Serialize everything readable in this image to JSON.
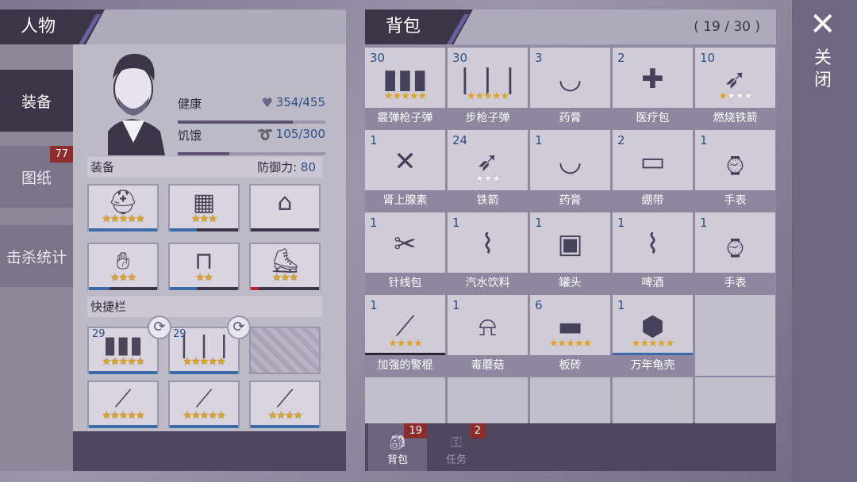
{
  "character": {
    "title": "人物",
    "tabs": [
      {
        "label": "装备"
      },
      {
        "label": "图纸",
        "badge": "77"
      },
      {
        "label": "击杀统计"
      }
    ],
    "stats": {
      "health_label": "健康",
      "health_value": "354/455",
      "health_fraction": 0.78,
      "hunger_label": "饥饿",
      "hunger_value": "105/300",
      "hunger_fraction": 0.35
    },
    "equipment_label": "装备",
    "defense_label": "防御力:",
    "defense_value": "80",
    "equipment": [
      {
        "icon": "helmet-icon",
        "stars": "★★★★★",
        "durability": 1.0
      },
      {
        "icon": "armor-vest-icon",
        "stars": "★★★",
        "durability": 0.4
      },
      {
        "icon": "jacket-icon",
        "stars": "",
        "durability": 0
      },
      {
        "icon": "gloves-icon",
        "stars": "★★★",
        "durability": 0.3
      },
      {
        "icon": "shorts-icon",
        "stars": "★★",
        "durability": 0.4
      },
      {
        "icon": "shoes-icon",
        "stars": "★★★",
        "durability": 0.12
      }
    ],
    "quickbar_label": "快捷栏",
    "quickbar": [
      {
        "icon": "shotgun-shell-icon",
        "count": "29",
        "stars": "★★★★★"
      },
      {
        "icon": "rifle-ammo-icon",
        "count": "29",
        "stars": "★★★★★"
      },
      {
        "icon": "empty-slot-icon",
        "count": "",
        "stars": ""
      },
      {
        "icon": "shotgun-icon",
        "count": "",
        "stars": "★★★★★"
      },
      {
        "icon": "rifle-icon",
        "count": "",
        "stars": "★★★★★"
      },
      {
        "icon": "baton-icon",
        "count": "",
        "stars": "★★★★"
      }
    ]
  },
  "backpack": {
    "title": "背包",
    "count": "( 19 / 30 )",
    "items": [
      {
        "qty": "30",
        "name": "霰弹枪子弹",
        "icon": "shotgun-shell-icon",
        "stars": "★★★★★",
        "grey": ""
      },
      {
        "qty": "30",
        "name": "步枪子弹",
        "icon": "rifle-ammo-icon",
        "stars": "★★★★★",
        "grey": ""
      },
      {
        "qty": "3",
        "name": "药膏",
        "icon": "mortar-icon",
        "stars": "",
        "grey": ""
      },
      {
        "qty": "2",
        "name": "医疗包",
        "icon": "medkit-icon",
        "stars": "",
        "grey": ""
      },
      {
        "qty": "10",
        "name": "燃烧铁箭",
        "icon": "fire-arrow-icon",
        "stars": "★",
        "grey": "★★★"
      },
      {
        "qty": "1",
        "name": "肾上腺素",
        "icon": "syringe-icon",
        "stars": "",
        "grey": ""
      },
      {
        "qty": "24",
        "name": "铁箭",
        "icon": "arrow-icon",
        "stars": "",
        "grey": "★★★"
      },
      {
        "qty": "1",
        "name": "药膏",
        "icon": "mortar-icon",
        "stars": "",
        "grey": ""
      },
      {
        "qty": "2",
        "name": "绷带",
        "icon": "bandage-icon",
        "stars": "",
        "grey": ""
      },
      {
        "qty": "1",
        "name": "手表",
        "icon": "watch-icon",
        "stars": "",
        "grey": ""
      },
      {
        "qty": "1",
        "name": "针线包",
        "icon": "sewing-kit-icon",
        "stars": "",
        "grey": ""
      },
      {
        "qty": "1",
        "name": "汽水饮料",
        "icon": "soda-icon",
        "stars": "",
        "grey": ""
      },
      {
        "qty": "1",
        "name": "罐头",
        "icon": "can-icon",
        "stars": "",
        "grey": ""
      },
      {
        "qty": "1",
        "name": "啤酒",
        "icon": "beer-icon",
        "stars": "",
        "grey": ""
      },
      {
        "qty": "1",
        "name": "手表",
        "icon": "watch-icon",
        "stars": "",
        "grey": ""
      },
      {
        "qty": "1",
        "name": "加强的警棍",
        "icon": "baton-icon",
        "stars": "★★★★",
        "grey": ""
      },
      {
        "qty": "1",
        "name": "毒蘑菇",
        "icon": "mushroom-icon",
        "stars": "",
        "grey": ""
      },
      {
        "qty": "6",
        "name": "板砖",
        "icon": "brick-icon",
        "stars": "★★★★★",
        "grey": ""
      },
      {
        "qty": "1",
        "name": "万年龟壳",
        "icon": "turtle-shell-icon",
        "stars": "★★★★★",
        "grey": ""
      }
    ],
    "tabs": [
      {
        "label": "背包",
        "badge": "19",
        "icon": "backpack-icon"
      },
      {
        "label": "任务",
        "badge": "2",
        "icon": "key-icon"
      }
    ]
  },
  "close_label": "关闭"
}
